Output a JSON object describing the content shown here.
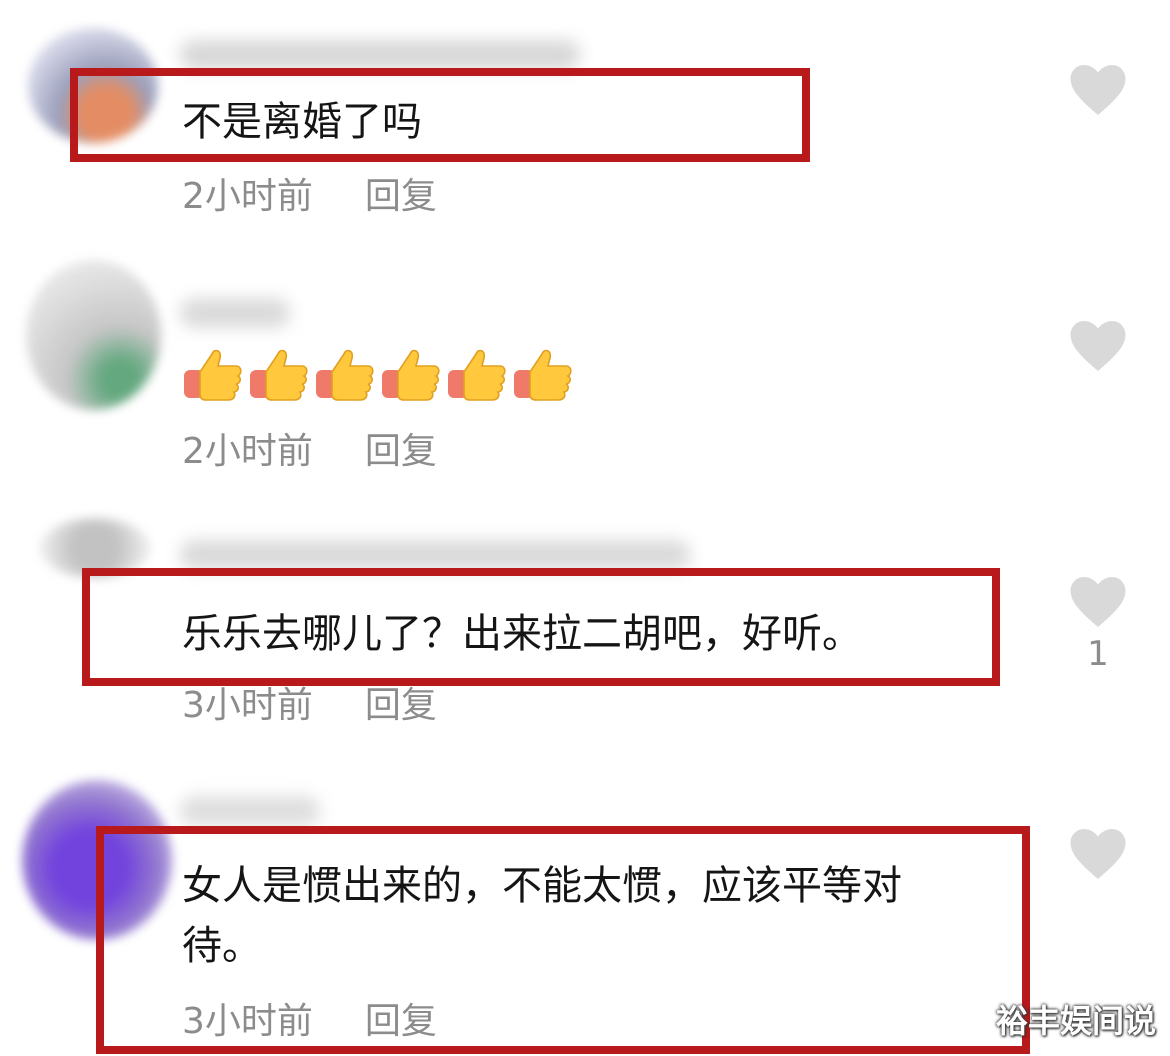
{
  "comments": [
    {
      "text": "不是离婚了吗",
      "time": "2小时前",
      "reply": "回复",
      "likes": ""
    },
    {
      "text": "",
      "time": "2小时前",
      "reply": "回复",
      "likes": ""
    },
    {
      "text": "乐乐去哪儿了？出来拉二胡吧，好听。",
      "time": "3小时前",
      "reply": "回复",
      "likes": "1"
    },
    {
      "text_line1": "女人是惯出来的，不能太惯，应该平等对",
      "text_line2": "待。",
      "time": "3小时前",
      "reply": "回复",
      "likes": ""
    }
  ],
  "emoji_reaction": {
    "icon": "thumbs-up-icon",
    "count": 6
  },
  "colors": {
    "highlight": "#b8191b",
    "meta": "#8c8c8c",
    "heart": "#d9d9d9"
  },
  "watermark": "裕丰娱间说"
}
